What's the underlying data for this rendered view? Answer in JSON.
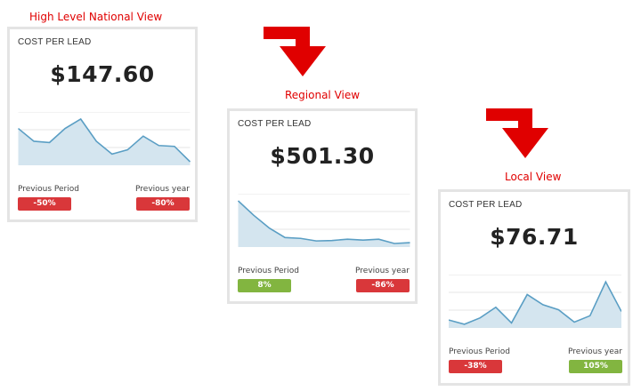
{
  "colors": {
    "negative": "#d9373a",
    "positive": "#82b540",
    "line": "#5a9ec4",
    "fill": "#d4e5ef",
    "title": "#e00000",
    "arrow": "#e00000"
  },
  "views": [
    {
      "title": "High Level National View",
      "metric_label": "COST PER LEAD",
      "value": "$147.60",
      "previous_period_label": "Previous Period",
      "previous_year_label": "Previous year",
      "previous_period_change": "-50%",
      "previous_period_status": "negative",
      "previous_year_change": "-80%",
      "previous_year_status": "negative",
      "sparkline": [
        0.78,
        0.48,
        0.45,
        0.78,
        1.0,
        0.48,
        0.18,
        0.28,
        0.6,
        0.38,
        0.36,
        0.0
      ]
    },
    {
      "title": "Regional View",
      "metric_label": "COST PER LEAD",
      "value": "$501.30",
      "previous_period_label": "Previous Period",
      "previous_year_label": "Previous year",
      "previous_period_change": "8%",
      "previous_period_status": "positive",
      "previous_year_change": "-86%",
      "previous_year_status": "negative",
      "sparkline": [
        1.0,
        0.66,
        0.36,
        0.14,
        0.12,
        0.06,
        0.07,
        0.1,
        0.08,
        0.1,
        0.0,
        0.02
      ]
    },
    {
      "title": "Local View",
      "metric_label": "COST PER LEAD",
      "value": "$76.71",
      "previous_period_label": "Previous Period",
      "previous_year_label": "Previous year",
      "previous_period_change": "-38%",
      "previous_period_status": "negative",
      "previous_year_change": "105%",
      "previous_year_status": "positive",
      "sparkline": [
        0.1,
        0.0,
        0.15,
        0.4,
        0.03,
        0.7,
        0.46,
        0.34,
        0.05,
        0.2,
        1.0,
        0.3
      ]
    }
  ]
}
